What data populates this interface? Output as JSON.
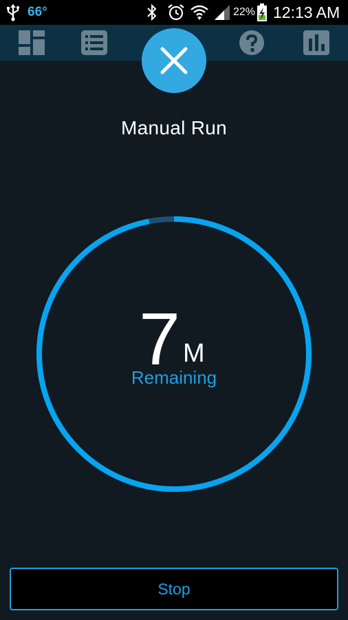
{
  "status_bar": {
    "temperature": "66°",
    "battery_percent": "22%",
    "time": "12:13 AM",
    "icons": [
      "usb-icon",
      "bluetooth-icon",
      "alarm-icon",
      "wifi-icon",
      "signal-icon",
      "battery-charging-icon"
    ]
  },
  "nav": {
    "items": [
      {
        "name": "dashboard-icon"
      },
      {
        "name": "list-icon"
      },
      {
        "name": "help-icon"
      },
      {
        "name": "stats-icon"
      }
    ],
    "close_icon": "close-icon"
  },
  "run": {
    "title": "Manual Run",
    "remaining_value": "7",
    "remaining_unit": "M",
    "remaining_label": "Remaining",
    "progress_elapsed_fraction": 0.03
  },
  "actions": {
    "stop_label": "Stop"
  },
  "colors": {
    "accent": "#1e9fe0",
    "close_circle": "#33a9e2",
    "nav_background": "#0c3144",
    "background": "#101a20",
    "ring_track": "#1f4f73"
  }
}
